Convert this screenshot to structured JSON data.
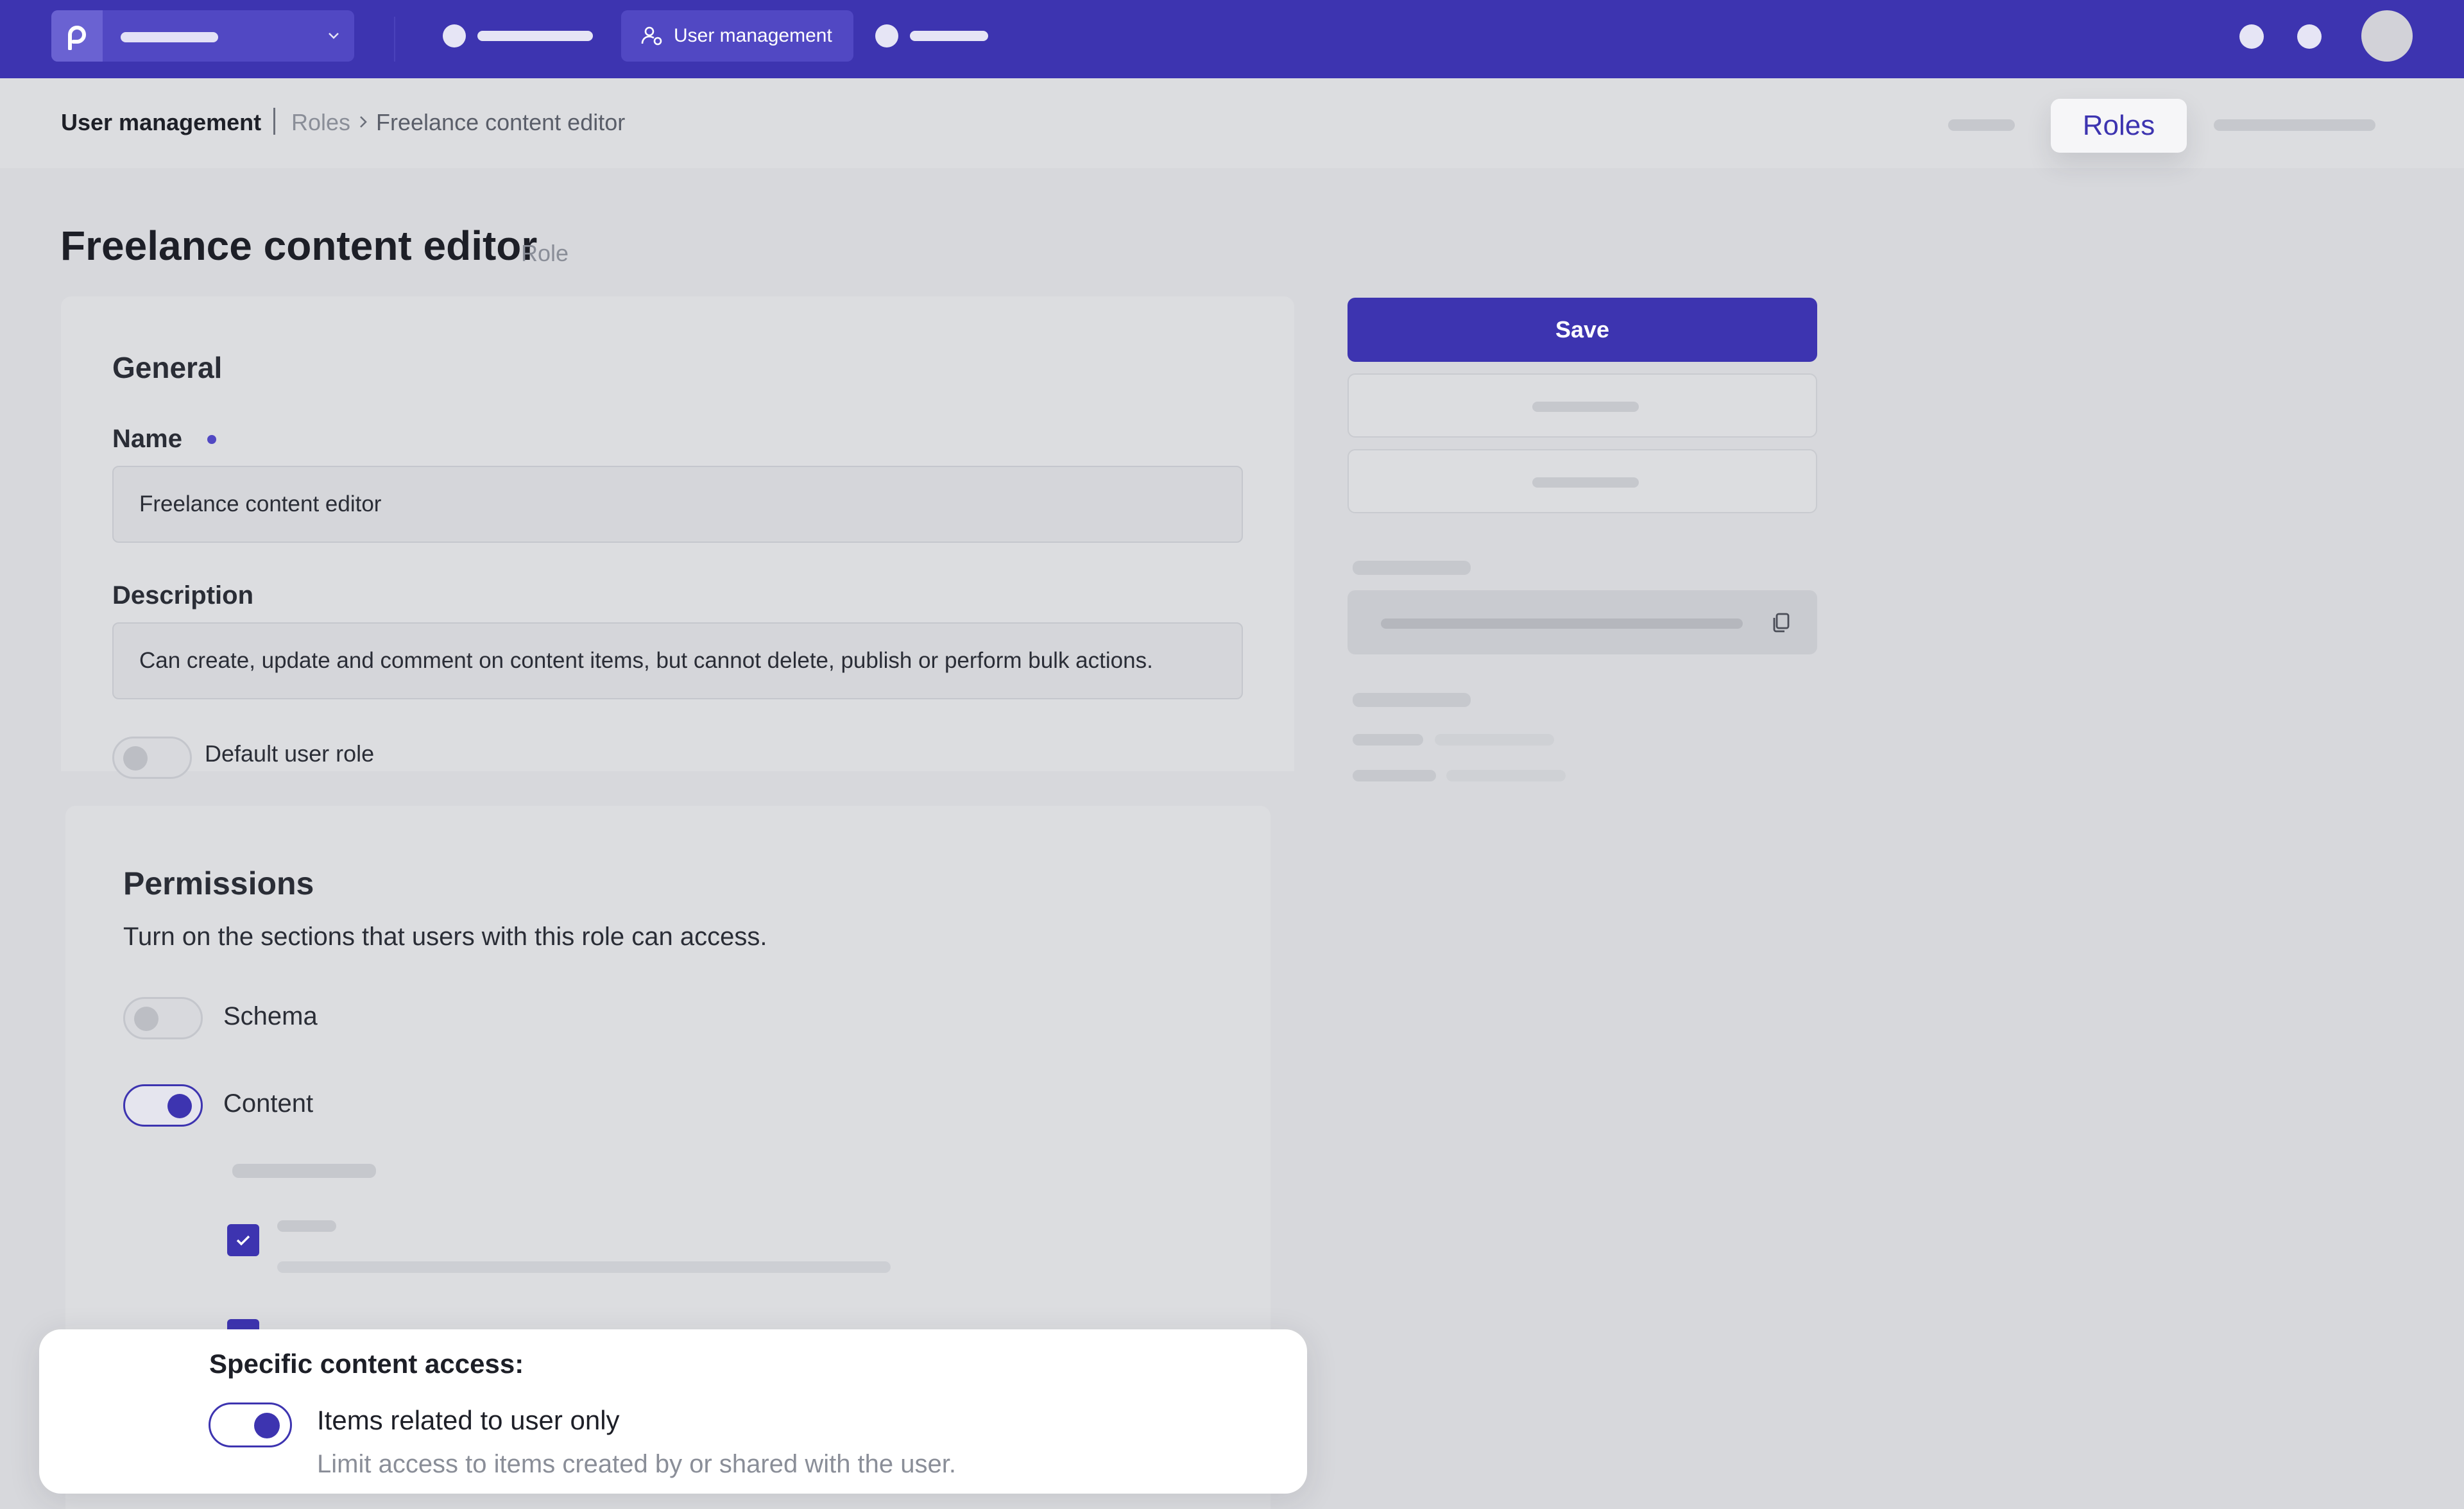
{
  "topbar": {
    "active_nav_label": "User management",
    "colors": {
      "brand": "#3d34b0",
      "brand_light": "#5148c3"
    }
  },
  "breadcrumb": {
    "section": "User management",
    "parent": "Roles",
    "current": "Freelance content editor"
  },
  "subheader": {
    "active_tab": "Roles"
  },
  "page": {
    "title": "Freelance content editor",
    "tag": "Role"
  },
  "general": {
    "heading": "General",
    "name_label": "Name",
    "name_value": "Freelance content editor",
    "description_label": "Description",
    "description_value": "Can create, update and comment on content items, but cannot delete, publish or perform bulk actions.",
    "default_role_label": "Default user role"
  },
  "actions": {
    "save_label": "Save"
  },
  "permissions": {
    "heading": "Permissions",
    "description": "Turn on the sections that users with this role can access.",
    "sections": [
      {
        "label": "Schema",
        "enabled": false
      },
      {
        "label": "Content",
        "enabled": true
      }
    ]
  },
  "popup": {
    "title": "Specific content access:",
    "option_label": "Items related to user only",
    "option_hint": "Limit access to items created by or shared with the user.",
    "option_enabled": true
  }
}
